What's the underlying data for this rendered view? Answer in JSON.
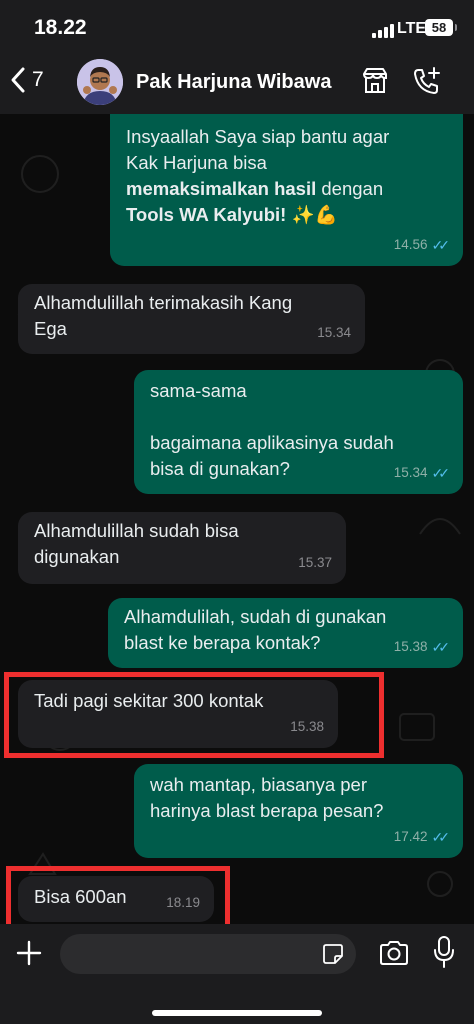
{
  "status_bar": {
    "time": "18.22",
    "network": "LTE",
    "battery": "58"
  },
  "header": {
    "back_count": "7",
    "contact_name": "Pak Harjuna Wibawa"
  },
  "messages": [
    {
      "dir": "out",
      "line1": "Insyaallah Saya siap bantu agar",
      "line2": "Kak Harjuna bisa",
      "bold1": "memaksimalkan hasil",
      "mid": " dengan",
      "bold2": "Tools WA Kalyubi!",
      "emoji": " ✨💪",
      "time": "14.56"
    },
    {
      "dir": "in",
      "text": "Alhamdulillah terimakasih Kang\nEga",
      "time": "15.34"
    },
    {
      "dir": "out",
      "text": "sama-sama\n\nbagaimana aplikasinya sudah\nbisa di gunakan?",
      "time": "15.34"
    },
    {
      "dir": "in",
      "text": "Alhamdulillah sudah bisa\ndigunakan",
      "time": "15.37"
    },
    {
      "dir": "out",
      "text": "Alhamdulilah, sudah di gunakan\nblast ke berapa kontak?",
      "time": "15.38"
    },
    {
      "dir": "in",
      "text": "Tadi pagi sekitar 300 kontak",
      "time": "15.38",
      "highlighted": true
    },
    {
      "dir": "out",
      "text": "wah mantap, biasanya per\nharinya blast berapa pesan?",
      "time": "17.42"
    },
    {
      "dir": "in",
      "text": "Bisa 600an",
      "time": "18.19",
      "highlighted": true
    }
  ],
  "input": {
    "placeholder": ""
  },
  "colors": {
    "outgoing": "#005c4b",
    "incoming": "#1f1f22",
    "highlight": "#ee2f2f",
    "read_ticks": "#53bdeb"
  }
}
